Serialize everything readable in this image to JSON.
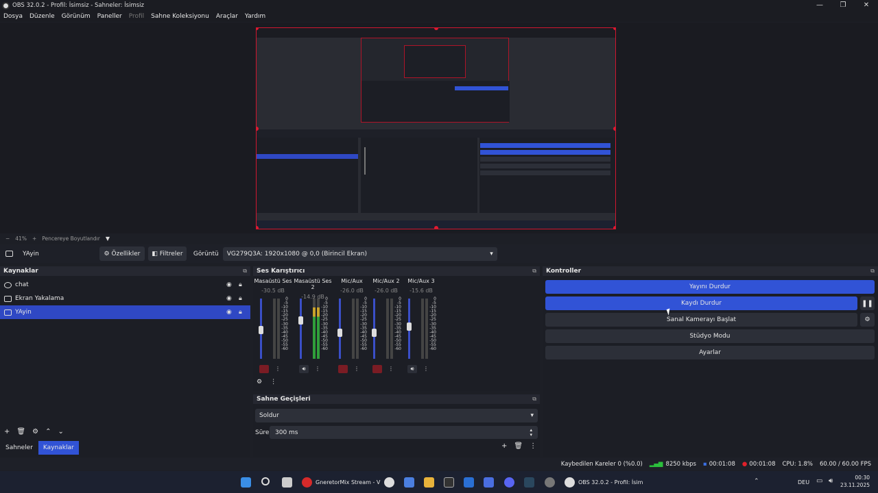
{
  "window": {
    "title": "OBS 32.0.2 - Profil: İsimsiz - Sahneler: İsimsiz",
    "controls": [
      "—",
      "❐",
      "✕"
    ]
  },
  "menu": [
    "Dosya",
    "Düzenle",
    "Görünüm",
    "Paneller",
    "Profil",
    "Sahne Koleksiyonu",
    "Araçlar",
    "Yardım"
  ],
  "zoom": {
    "minus": "−",
    "value": "41%",
    "plus": "+",
    "fit": "Pencereye Boyutlandır",
    "caret": "▼"
  },
  "sourcebar": {
    "source_name": "YAyin",
    "properties": "Özellikler",
    "filters": "Filtreler",
    "display_label": "Görüntü",
    "display_value": "VG279Q3A: 1920x1080 @ 0,0 (Birincil Ekran)"
  },
  "sources": {
    "title": "Kaynaklar",
    "items": [
      {
        "label": "chat"
      },
      {
        "label": "Ekran Yakalama"
      },
      {
        "label": "YAyin"
      }
    ],
    "tabs": [
      "Sahneler",
      "Kaynaklar"
    ]
  },
  "mixer": {
    "title": "Ses Karıştırıcı",
    "channels": [
      {
        "name": "Masaüstü Ses",
        "db": "-30.5 dB",
        "level": 0.55
      },
      {
        "name": "Masaüstü Ses 2",
        "db": "-14.9 dB",
        "level": 0.7
      },
      {
        "name": "Mic/Aux",
        "db": "-26.0 dB",
        "level": 0.5
      },
      {
        "name": "Mic/Aux 2",
        "db": "-26.0 dB",
        "level": 0.5
      },
      {
        "name": "Mic/Aux 3",
        "db": "-15.6 dB",
        "level": 0.6
      }
    ],
    "scale": [
      "0",
      "-5",
      "-10",
      "-15",
      "-20",
      "-25",
      "-30",
      "-35",
      "-40",
      "-45",
      "-50",
      "-55",
      "-60"
    ]
  },
  "transitions": {
    "title": "Sahne Geçişleri",
    "selected": "Soldur",
    "duration_label": "Süre",
    "duration_value": "300 ms"
  },
  "controls": {
    "title": "Kontroller",
    "stop_stream": "Yayını Durdur",
    "stop_record": "Kaydı Durdur",
    "virtual_cam": "Sanal Kamerayı Başlat",
    "studio_mode": "Stüdyo Modu",
    "settings": "Ayarlar"
  },
  "status": {
    "dropped": "Kaybedilen Kareler 0 (%0.0)",
    "bitrate": "8250 kbps",
    "stream_time": "00:01:08",
    "rec_time": "00:01:08",
    "cpu": "CPU: 1.8%",
    "fps": "60.00 / 60.00 FPS"
  },
  "taskbar": {
    "app1": "GneretorMix Stream - V",
    "app2": "OBS 32.0.2 - Profil: İsim",
    "lang": "DEU",
    "time": "00:30",
    "date": "23.11.2025"
  },
  "colors": {
    "accent": "#3153d6",
    "selection": "#2f48c4",
    "preview_border": "#d2162f",
    "record": "#e0202a"
  }
}
